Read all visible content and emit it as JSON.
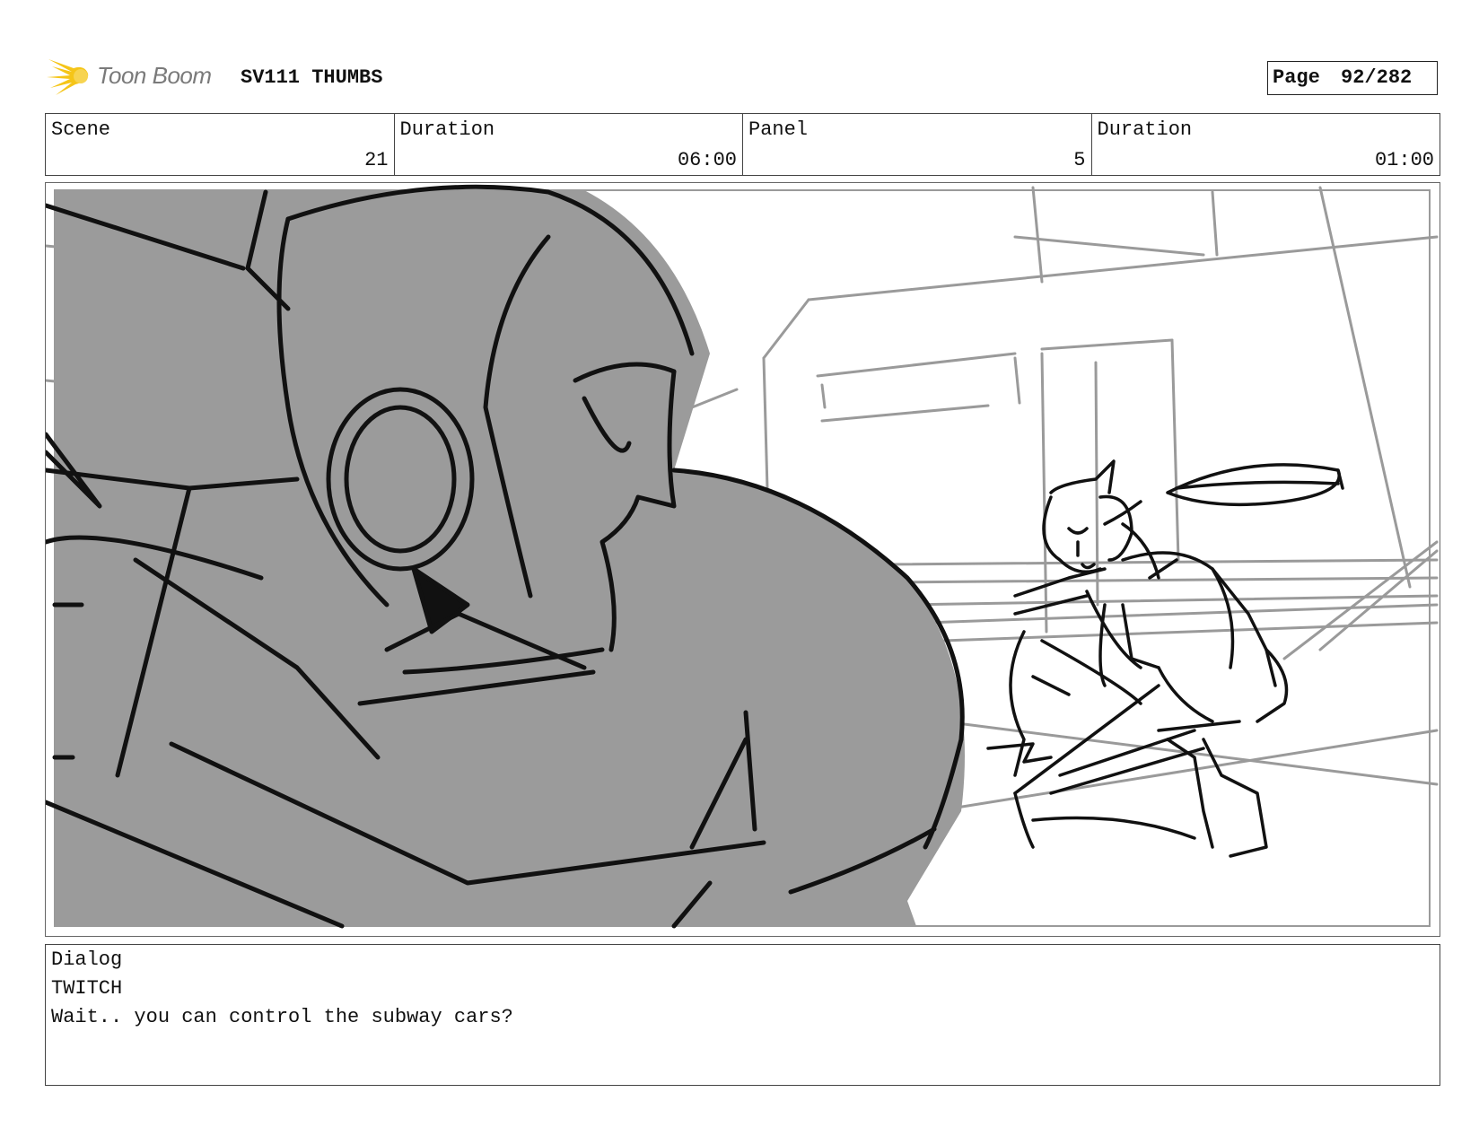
{
  "header": {
    "logo_text": "Toon Boom",
    "project_title": "SV111 THUMBS",
    "page_label": "Page",
    "page_value": "92/282"
  },
  "info": {
    "scene_label": "Scene",
    "scene_value": "21",
    "scene_duration_label": "Duration",
    "scene_duration_value": "06:00",
    "panel_label": "Panel",
    "panel_value": "5",
    "panel_duration_label": "Duration",
    "panel_duration_value": "01:00"
  },
  "dialog": {
    "label": "Dialog",
    "character": "TWITCH",
    "line": "Wait.. you can control the subway cars?"
  },
  "colors": {
    "logo_yellow": "#f5c518",
    "sketch_fill": "#9b9b9b",
    "sketch_line": "#111111",
    "background_line": "#9a9a9a"
  }
}
